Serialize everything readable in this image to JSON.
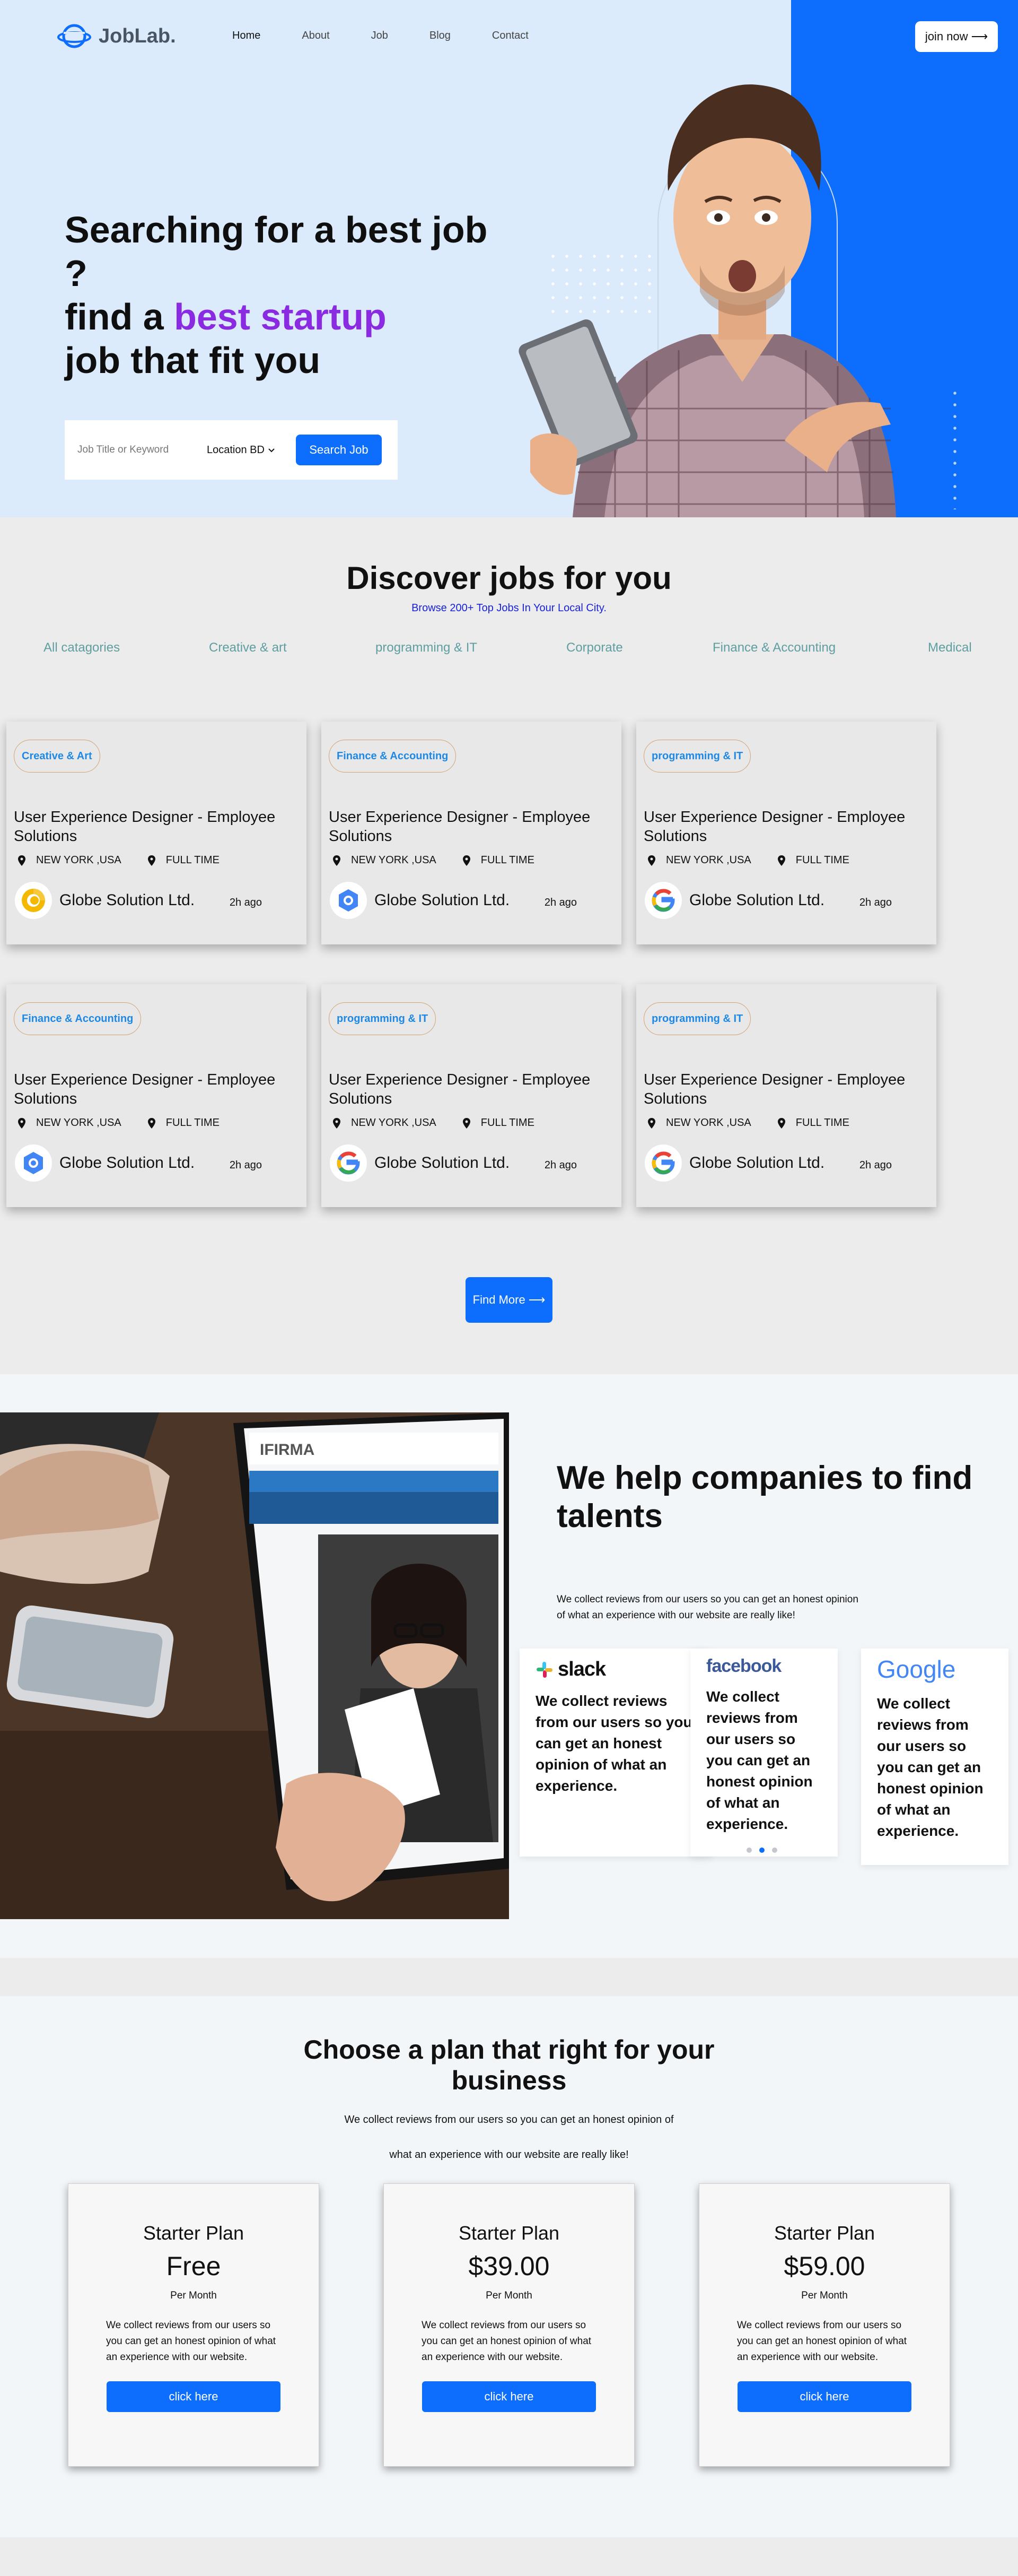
{
  "brand": {
    "name": "JobLab.",
    "accent": "#0d6efd",
    "purple": "#8a2be2"
  },
  "nav": {
    "items": [
      "Home",
      "About",
      "Job",
      "Blog",
      "Contact"
    ],
    "join_label": "join now ⟶"
  },
  "hero": {
    "title_line1": "Searching for a best job",
    "title_line2": "?",
    "title_line3_pre": "find a ",
    "title_line3_accent": "best startup",
    "title_line4": "job that fit you",
    "search_placeholder": "Job Title or Keyword",
    "location_label": "Location BD",
    "search_button": "Search Job"
  },
  "jobs": {
    "title": "Discover jobs for you",
    "subtitle": "Browse 200+ Top Jobs In Your Local City.",
    "categories": [
      "All catagories",
      "Creative & art",
      "programming & IT",
      "Corporate",
      "Finance & Accounting",
      "Medical"
    ],
    "cards": [
      {
        "tag": "Creative & Art",
        "title": "User Experience Designer - Employee Solutions",
        "location": "NEW YORK ,USA",
        "type": "FULL TIME",
        "company": "Globe Solution Ltd.",
        "time": "2h ago",
        "logo": "chrome-icon"
      },
      {
        "tag": "Finance & Accounting",
        "title": "User Experience Designer - Employee Solutions",
        "location": "NEW YORK ,USA",
        "type": "FULL TIME",
        "company": "Globe Solution Ltd.",
        "time": "2h ago",
        "logo": "gear-hex-icon"
      },
      {
        "tag": "programming & IT",
        "title": "User Experience Designer - Employee Solutions",
        "location": "NEW YORK ,USA",
        "type": "FULL TIME",
        "company": "Globe Solution Ltd.",
        "time": "2h ago",
        "logo": "google-icon"
      },
      {
        "tag": "Finance & Accounting",
        "title": "User Experience Designer - Employee Solutions",
        "location": "NEW YORK ,USA",
        "type": "FULL TIME",
        "company": "Globe Solution Ltd.",
        "time": "2h ago",
        "logo": "gear-hex-icon"
      },
      {
        "tag": "programming & IT",
        "title": "User Experience Designer - Employee Solutions",
        "location": "NEW YORK ,USA",
        "type": "FULL TIME",
        "company": "Globe Solution Ltd.",
        "time": "2h ago",
        "logo": "google-icon"
      },
      {
        "tag": "programming & IT",
        "title": "User Experience Designer - Employee Solutions",
        "location": "NEW YORK ,USA",
        "type": "FULL TIME",
        "company": "Globe Solution Ltd.",
        "time": "2h ago",
        "logo": "google-icon"
      }
    ],
    "find_more": "Find More ⟶"
  },
  "help": {
    "title": "We help companies to find talents",
    "text": "We collect reviews from our users so you can get an honest opinion of what an experience with our website are really like!",
    "reviews": [
      {
        "brand": "slack",
        "text": "We collect reviews from our users so you can get an honest opinion of what an experience."
      },
      {
        "brand": "facebook",
        "text": "We collect reviews from our users so you can get an honest opinion of what an experience."
      },
      {
        "brand": "Google",
        "text": "We collect reviews from our users so you can get an honest opinion of what an experience."
      }
    ]
  },
  "plans": {
    "title": "Choose a plan that right for your business",
    "subtitle_line1": "We collect reviews from our users so you can get an honest opinion of",
    "subtitle_line2": "what an experience with our website are really like!",
    "items": [
      {
        "name": "Starter Plan",
        "price": "Free",
        "per": "Per Month",
        "desc": "We collect reviews from our users so you can get an honest opinion of what an experience with our website.",
        "button": "click here"
      },
      {
        "name": "Starter Plan",
        "price": "$39.00",
        "per": "Per Month",
        "desc": "We collect reviews from our users so you can get an honest opinion of what an experience with our website.",
        "button": "click here"
      },
      {
        "name": "Starter Plan",
        "price": "$59.00",
        "per": "Per Month",
        "desc": "We collect reviews from our users so you can get an honest opinion of what an experience with our website.",
        "button": "click here"
      }
    ]
  }
}
